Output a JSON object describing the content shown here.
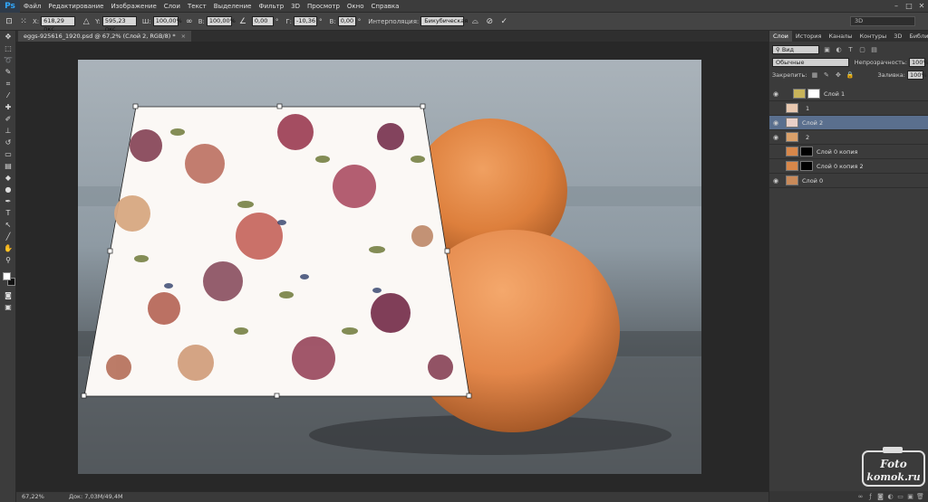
{
  "app": {
    "logo": "Ps"
  },
  "menu": [
    "Файл",
    "Редактирование",
    "Изображение",
    "Слои",
    "Текст",
    "Выделение",
    "Фильтр",
    "3D",
    "Просмотр",
    "Окно",
    "Справка"
  ],
  "options": {
    "x_label": "X:",
    "x_value": "618,29 пкс",
    "y_label": "Y:",
    "y_value": "595,23 пкс",
    "w_label": "Ш:",
    "w_value": "100,00%",
    "h_label": "В:",
    "h_value": "100,00%",
    "angle_value": "0,00",
    "angle_unit": "°",
    "hskew_label": "Г:",
    "hskew_value": "-10,36",
    "hskew_unit": "°",
    "vskew_label": "В:",
    "vskew_value": "0,00",
    "vskew_unit": "°",
    "interp_label": "Интерполяция:",
    "interp_value": "Бикубическая",
    "workspace": "3D"
  },
  "document": {
    "tab": "eggs-925616_1920.psd @ 67,2% (Слой 2, RGB/8) *",
    "close": "×"
  },
  "status": {
    "zoom": "67,22%",
    "doc": "Док: 7,03M/49,4M"
  },
  "panel": {
    "tabs": [
      "Слои",
      "История",
      "Каналы",
      "Контуры",
      "3D",
      "Библиотеки"
    ],
    "kind": "Вид",
    "blend": "Обычные",
    "opacity_label": "Непрозрачность:",
    "opacity": "100%",
    "lock_label": "Закрепить:",
    "fill_label": "Заливка:",
    "fill": "100%",
    "layers": [
      {
        "name": "Слой 1",
        "selected": false,
        "visible": true
      },
      {
        "name": "1",
        "selected": false,
        "visible": false
      },
      {
        "name": "Слой 2",
        "selected": true,
        "visible": true
      },
      {
        "name": "2",
        "selected": false,
        "visible": true
      },
      {
        "name": "Слой 0 копия",
        "selected": false,
        "visible": false
      },
      {
        "name": "Слой 0 копия 2",
        "selected": false,
        "visible": false
      },
      {
        "name": "Слой 0",
        "selected": false,
        "visible": true
      }
    ]
  },
  "watermark": {
    "line1": "Foto",
    "line2": "komok.ru"
  },
  "colors": {
    "accent": "#31a8ff",
    "selection": "#5a6f8e",
    "egg": "#e3874a"
  }
}
